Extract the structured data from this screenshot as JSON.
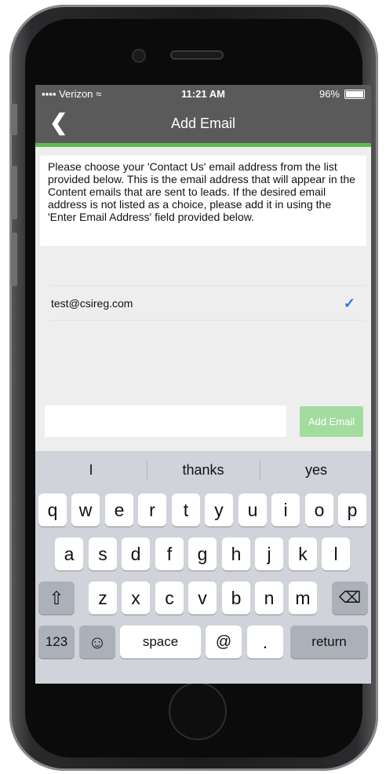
{
  "status_bar": {
    "carrier": "Verizon",
    "time": "11:21 AM",
    "battery": "96%"
  },
  "nav": {
    "title": "Add Email",
    "back_glyph": "❮"
  },
  "info_text": "Please choose your 'Contact Us' email address from the list provided below. This is the email address that will appear in the Content emails that are sent to leads. If the desired email address is not listed as a choice, please add it in using the 'Enter Email Address' field provided below.",
  "email_list": [
    {
      "email": "test@csireg.com",
      "selected": true,
      "check_glyph": "✓"
    }
  ],
  "email_input": {
    "value": "",
    "placeholder": ""
  },
  "add_button": {
    "label": "Add Email"
  },
  "keyboard": {
    "suggestions": [
      "I",
      "thanks",
      "yes"
    ],
    "row1": [
      "q",
      "w",
      "e",
      "r",
      "t",
      "y",
      "u",
      "i",
      "o",
      "p"
    ],
    "row2": [
      "a",
      "s",
      "d",
      "f",
      "g",
      "h",
      "j",
      "k",
      "l"
    ],
    "row3": [
      "z",
      "x",
      "c",
      "v",
      "b",
      "n",
      "m"
    ],
    "shift_glyph": "⇧",
    "delete_glyph": "⌫",
    "numbers_label": "123",
    "emoji_glyph": "☺",
    "space_label": "space",
    "at_label": "@",
    "period_label": ".",
    "return_label": "return"
  },
  "colors": {
    "nav_bg": "#5a5a5a",
    "accent_green": "#5dbb4f",
    "button_green": "#a4dca0",
    "check_blue": "#1e7bf0"
  }
}
